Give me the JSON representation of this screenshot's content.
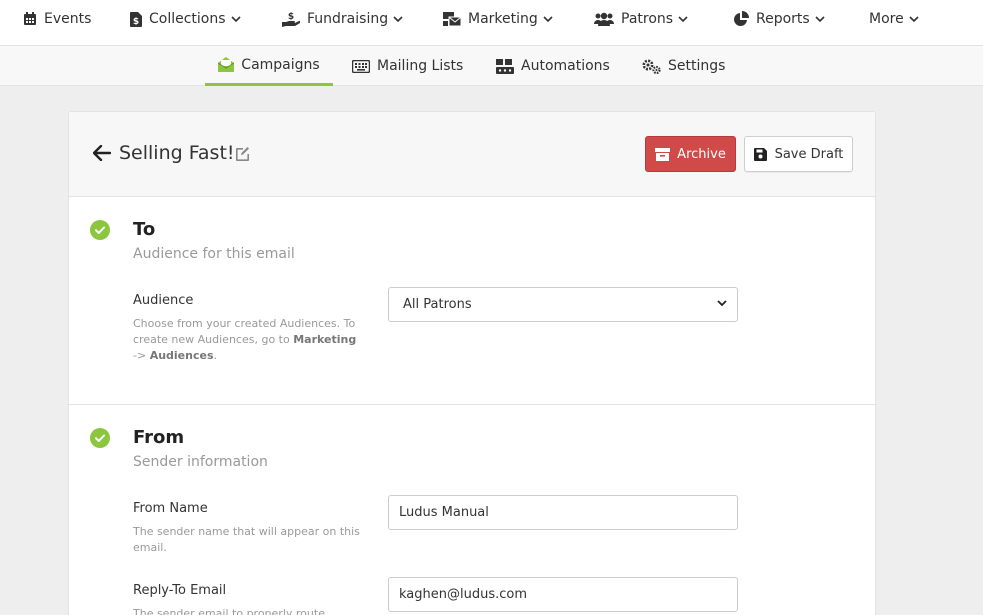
{
  "topnav": {
    "items": [
      {
        "label": "Events",
        "icon": "calendar-icon",
        "dropdown": false
      },
      {
        "label": "Collections",
        "icon": "dollar-doc-icon",
        "dropdown": true
      },
      {
        "label": "Fundraising",
        "icon": "hand-dollar-icon",
        "dropdown": true
      },
      {
        "label": "Marketing",
        "icon": "mail-bulk-icon",
        "dropdown": true
      },
      {
        "label": "Patrons",
        "icon": "users-icon",
        "dropdown": true
      },
      {
        "label": "Reports",
        "icon": "pie-chart-icon",
        "dropdown": true
      },
      {
        "label": "More",
        "icon": "",
        "dropdown": true
      }
    ]
  },
  "subnav": {
    "items": [
      {
        "label": "Campaigns",
        "icon": "envelope-open-icon",
        "active": true
      },
      {
        "label": "Mailing Lists",
        "icon": "keyboard-icon",
        "active": false
      },
      {
        "label": "Automations",
        "icon": "automation-icon",
        "active": false
      },
      {
        "label": "Settings",
        "icon": "cogs-icon",
        "active": false
      }
    ],
    "accent": "#8cc63f"
  },
  "campaign": {
    "title": "Selling Fast!",
    "archive_label": "Archive",
    "save_draft_label": "Save Draft"
  },
  "to_section": {
    "title": "To",
    "subtitle": "Audience for this email",
    "audience_label": "Audience",
    "audience_help_1": "Choose from your created Audiences. To create new Audiences, go to ",
    "audience_help_bold_1": "Marketing",
    "audience_help_arrow": " -> ",
    "audience_help_bold_2": "Audiences",
    "audience_help_end": ".",
    "audience_value": "All Patrons"
  },
  "from_section": {
    "title": "From",
    "subtitle": "Sender information",
    "from_name_label": "From Name",
    "from_name_help": "The sender name that will appear on this email.",
    "from_name_value": "Ludus Manual",
    "reply_to_label": "Reply-To Email",
    "reply_to_help": "The sender email to properly route",
    "reply_to_value": "kaghen@ludus.com"
  },
  "colors": {
    "check_green": "#8cc63f",
    "archive_red": "#d14a4a"
  }
}
